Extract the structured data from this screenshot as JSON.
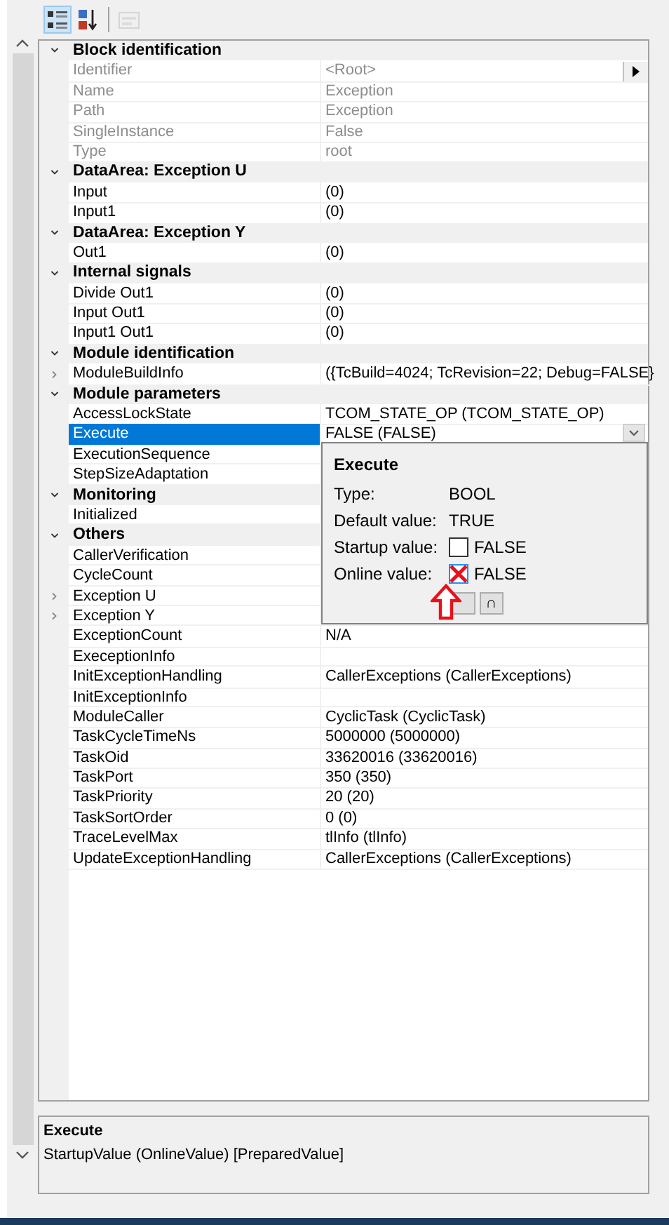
{
  "toolbar": [
    {
      "kind": "categorized",
      "selected": true,
      "disabled": false
    },
    {
      "kind": "alphabetical",
      "selected": false,
      "disabled": false
    },
    {
      "kind": "pages",
      "selected": false,
      "disabled": true
    }
  ],
  "categories": [
    {
      "title": "Block identification",
      "expanded": true,
      "rows": [
        {
          "name": "Identifier",
          "value": "<Root>",
          "disabled": true,
          "selected": false
        },
        {
          "name": "Name",
          "value": "Exception",
          "disabled": true,
          "selected": false
        },
        {
          "name": "Path",
          "value": "Exception",
          "disabled": true,
          "selected": false
        },
        {
          "name": "SingleInstance",
          "value": "False",
          "disabled": true,
          "selected": false
        },
        {
          "name": "Type",
          "value": "root",
          "disabled": true,
          "selected": false
        }
      ]
    },
    {
      "title": "DataArea: Exception  U",
      "expanded": true,
      "rows": [
        {
          "name": "Input",
          "value": "(0)",
          "disabled": false,
          "selected": false
        },
        {
          "name": "Input1",
          "value": "(0)",
          "disabled": false,
          "selected": false
        }
      ]
    },
    {
      "title": "DataArea: Exception  Y",
      "expanded": true,
      "rows": [
        {
          "name": "Out1",
          "value": "(0)",
          "disabled": false,
          "selected": false
        }
      ]
    },
    {
      "title": "Internal signals",
      "expanded": true,
      "rows": [
        {
          "name": "Divide  Out1",
          "value": "(0)",
          "disabled": false,
          "selected": false
        },
        {
          "name": "Input  Out1",
          "value": "(0)",
          "disabled": false,
          "selected": false
        },
        {
          "name": "Input1  Out1",
          "value": "(0)",
          "disabled": false,
          "selected": false
        }
      ]
    },
    {
      "title": "Module identification",
      "expanded": true,
      "rows": [
        {
          "name": "ModuleBuildInfo",
          "value": "({TcBuild=4024; TcRevision=22; Debug=FALSE}",
          "disabled": false,
          "selected": false,
          "expanded": false
        }
      ]
    },
    {
      "title": "Module parameters",
      "expanded": true,
      "rows": [
        {
          "name": "AccessLockState",
          "value": "TCOM_STATE_OP (TCOM_STATE_OP)",
          "disabled": false,
          "selected": false
        },
        {
          "name": "Execute",
          "value": "FALSE (FALSE)",
          "disabled": false,
          "selected": true
        },
        {
          "name": "ExecutionSequence",
          "disabled": false,
          "selected": false
        },
        {
          "name": "StepSizeAdaptation",
          "disabled": false,
          "selected": false
        }
      ]
    },
    {
      "title": "Monitoring",
      "expanded": true,
      "rows": [
        {
          "name": "Initialized",
          "disabled": false,
          "selected": false
        }
      ]
    },
    {
      "title": "Others",
      "expanded": true,
      "rows": [
        {
          "name": "CallerVerification",
          "disabled": false,
          "selected": false
        },
        {
          "name": "CycleCount",
          "disabled": false,
          "selected": false
        },
        {
          "name": "Exception  U",
          "disabled": false,
          "selected": false,
          "expanded": false
        },
        {
          "name": "Exception  Y",
          "disabled": false,
          "selected": false,
          "expanded": false
        },
        {
          "name": "ExceptionCount",
          "value": "N/A",
          "disabled": false,
          "selected": false
        },
        {
          "name": "ExeceptionInfo",
          "disabled": false,
          "selected": false
        },
        {
          "name": "InitExceptionHandling",
          "value": "CallerExceptions (CallerExceptions)",
          "disabled": false,
          "selected": false
        },
        {
          "name": "InitExceptionInfo",
          "disabled": false,
          "selected": false
        },
        {
          "name": "ModuleCaller",
          "value": "CyclicTask (CyclicTask)",
          "disabled": false,
          "selected": false
        },
        {
          "name": "TaskCycleTimeNs",
          "value": "5000000 (5000000)",
          "disabled": false,
          "selected": false
        },
        {
          "name": "TaskOid",
          "value": "33620016 (33620016)",
          "disabled": false,
          "selected": false
        },
        {
          "name": "TaskPort",
          "value": "350 (350)",
          "disabled": false,
          "selected": false
        },
        {
          "name": "TaskPriority",
          "value": "20 (20)",
          "disabled": false,
          "selected": false
        },
        {
          "name": "TaskSortOrder",
          "value": "0 (0)",
          "disabled": false,
          "selected": false
        },
        {
          "name": "TraceLevelMax",
          "value": "tlInfo (tlInfo)",
          "disabled": false,
          "selected": false
        },
        {
          "name": "UpdateExceptionHandling",
          "value": "CallerExceptions (CallerExceptions)",
          "disabled": false,
          "selected": false
        }
      ]
    }
  ],
  "popup": {
    "title": "Execute",
    "fields": [
      {
        "kind": "text",
        "label": "Type:",
        "value": "BOOL"
      },
      {
        "kind": "text",
        "label": "Default value:",
        "value": "TRUE"
      },
      {
        "kind": "check",
        "label": "Startup value:",
        "value": "FALSE",
        "checked": false
      },
      {
        "kind": "check",
        "label": "Online value:",
        "value": "FALSE",
        "checked": true
      }
    ],
    "buttons": [
      {
        "kind": "blank"
      },
      {
        "kind": "text",
        "label": "∩"
      }
    ]
  },
  "description": {
    "title": "Execute",
    "text": "StartupValue (OnlineValue) [PreparedValue]"
  }
}
